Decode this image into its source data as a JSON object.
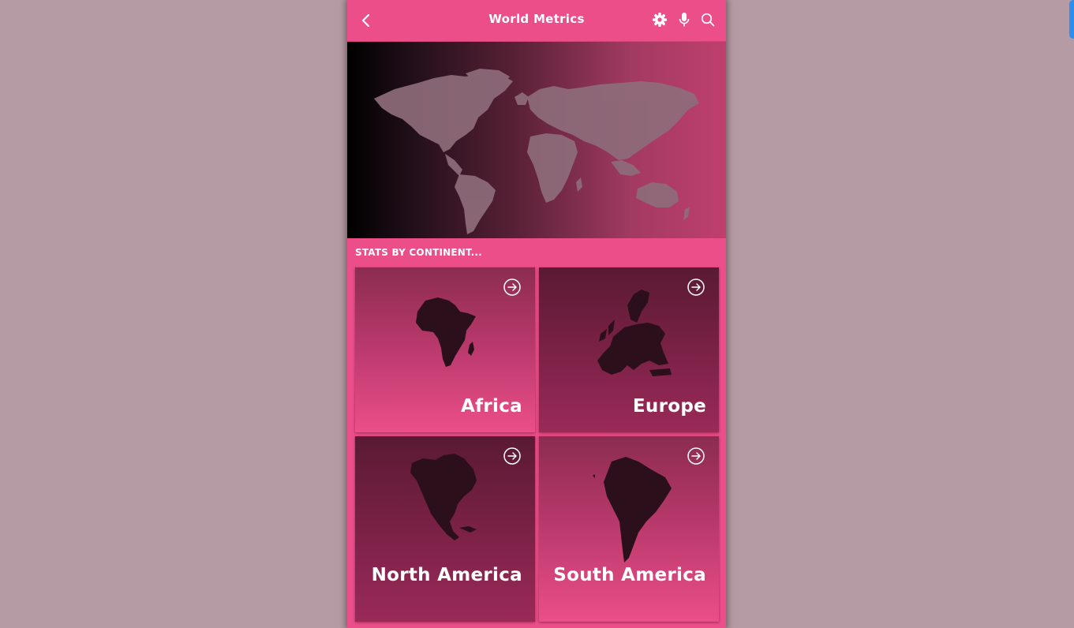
{
  "appbar": {
    "title": "World Metrics",
    "back_icon": "chevron-left-icon",
    "actions": [
      "gear-icon",
      "microphone-icon",
      "search-icon"
    ]
  },
  "section": {
    "title": "STATS BY CONTINENT..."
  },
  "cards": [
    {
      "label": "Africa",
      "icon": "arrow-right-circle-icon"
    },
    {
      "label": "Europe",
      "icon": "arrow-right-circle-icon"
    },
    {
      "label": "North America",
      "icon": "arrow-right-circle-icon"
    },
    {
      "label": "South America",
      "icon": "arrow-right-circle-icon"
    }
  ],
  "colors": {
    "accent": "#ec4e89",
    "page_background": "#b59ca4",
    "map_fill": "#8c6a78",
    "continent_fill": "#2b0f1a"
  }
}
